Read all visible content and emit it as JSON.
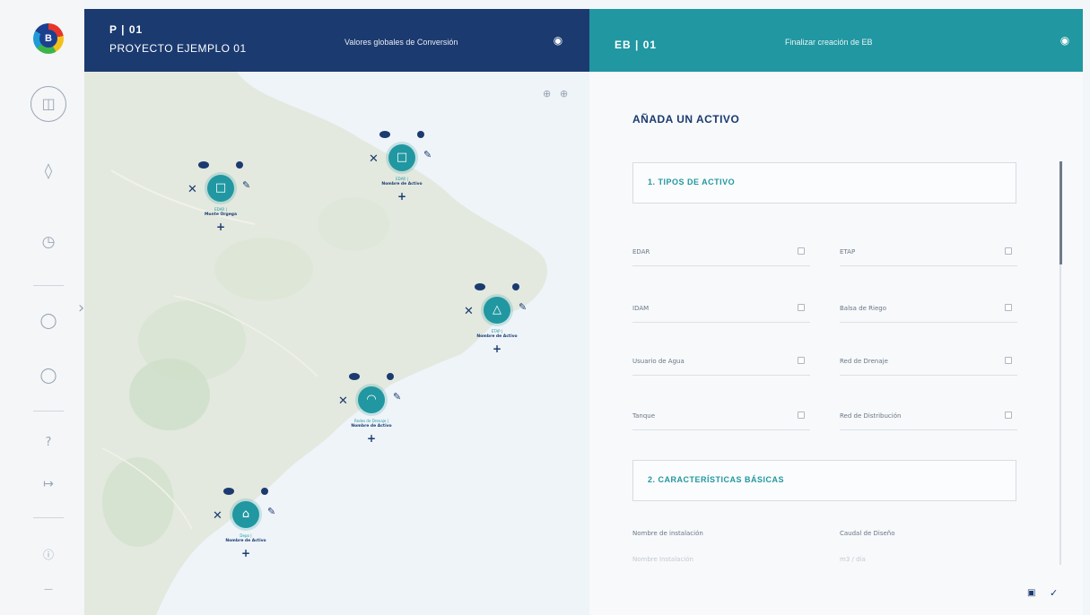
{
  "sidebar": {
    "logo_letter": "B",
    "icons": [
      "database-icon",
      "layers-icon",
      "gauge-icon",
      "user-icon",
      "users-icon",
      "help-icon",
      "logout-icon",
      "info-icon",
      "more-icon"
    ]
  },
  "header_left": {
    "code": "P | 01",
    "project_name": "PROYECTO EJEMPLO 01",
    "link": "Valores globales de Conversión"
  },
  "header_right": {
    "code": "EB | 01",
    "link": "Finalizar creación de EB"
  },
  "map": {
    "markers": [
      {
        "type": "EDAR |",
        "name": "Monte Orgega",
        "icon": "document-icon"
      },
      {
        "type": "EDAR |",
        "name": "Nombre de Activo",
        "icon": "document-icon"
      },
      {
        "type": "ETAP |",
        "name": "Nombre de Activo",
        "icon": "drop-icon"
      },
      {
        "type": "Redes de Drenaje |",
        "name": "Nombre de Activo",
        "icon": "dome-icon"
      },
      {
        "type": "Depo |",
        "name": "Nombre de Activo",
        "icon": "tank-icon"
      }
    ]
  },
  "panel": {
    "title": "AÑADA UN ACTIVO",
    "section1_title": "1. TIPOS DE ACTIVO",
    "asset_types": [
      {
        "label": "EDAR",
        "checked": false
      },
      {
        "label": "ETAP",
        "checked": false
      },
      {
        "label": "IDAM",
        "checked": false
      },
      {
        "label": "Balsa de Riego",
        "checked": false
      },
      {
        "label": "Usuario de Agua",
        "checked": false
      },
      {
        "label": "Red de Drenaje",
        "checked": false
      },
      {
        "label": "Tanque",
        "checked": false
      },
      {
        "label": "Red de Distribución",
        "checked": false
      }
    ],
    "section2_title": "2. CARACTERÍSTICAS BÁSICAS",
    "fields": [
      {
        "label": "Nombre de instalación",
        "placeholder": "Nombre Instalación"
      },
      {
        "label": "Caudal de Diseño",
        "placeholder": "m3 / día"
      }
    ]
  },
  "colors": {
    "navy": "#1b3a70",
    "teal": "#2197a1"
  }
}
